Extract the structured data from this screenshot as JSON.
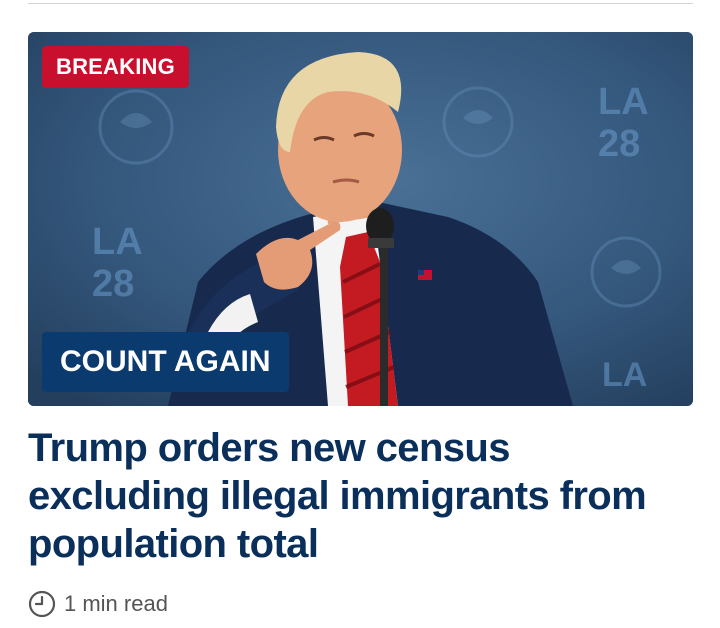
{
  "article": {
    "badge": "BREAKING",
    "kicker": "COUNT AGAIN",
    "headline": "Trump orders new census excluding illegal immigrants from population total",
    "read_time": "1 min read",
    "image_alt": "Man in navy suit and red striped tie pointing while speaking at a podium microphone in front of a blue backdrop with LA28 logos",
    "backdrop_text": "LA 28"
  },
  "colors": {
    "breaking_red": "#c8102e",
    "kicker_navy": "#0b3a6e",
    "headline_navy": "#0b2f5b",
    "meta_gray": "#555555"
  },
  "icons": {
    "read_time": "clock-icon"
  }
}
